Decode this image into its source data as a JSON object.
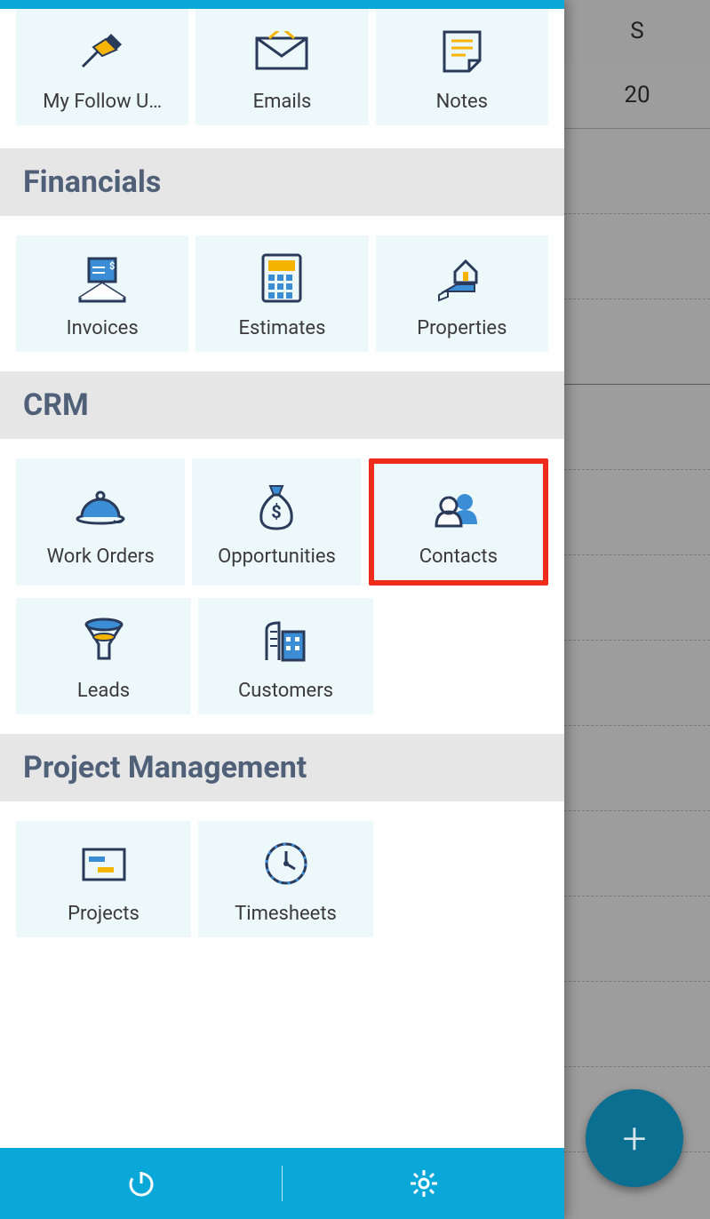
{
  "background": {
    "day_header": "S",
    "day_number": "20"
  },
  "sections": {
    "top_row": {
      "items": [
        {
          "label": "My Follow U…",
          "icon": "pushpin"
        },
        {
          "label": "Emails",
          "icon": "envelope"
        },
        {
          "label": "Notes",
          "icon": "note"
        }
      ]
    },
    "financials": {
      "title": "Financials",
      "items": [
        {
          "label": "Invoices",
          "icon": "invoice"
        },
        {
          "label": "Estimates",
          "icon": "calculator"
        },
        {
          "label": "Properties",
          "icon": "property"
        }
      ]
    },
    "crm": {
      "title": "CRM",
      "row1": [
        {
          "label": "Work Orders",
          "icon": "workorder"
        },
        {
          "label": "Opportunities",
          "icon": "moneybag"
        },
        {
          "label": "Contacts",
          "icon": "contacts",
          "highlight": true
        }
      ],
      "row2": [
        {
          "label": "Leads",
          "icon": "funnel"
        },
        {
          "label": "Customers",
          "icon": "buildings"
        }
      ]
    },
    "pm": {
      "title": "Project Management",
      "items": [
        {
          "label": "Projects",
          "icon": "project"
        },
        {
          "label": "Timesheets",
          "icon": "clock"
        }
      ]
    }
  },
  "fab": {
    "label": "+"
  }
}
